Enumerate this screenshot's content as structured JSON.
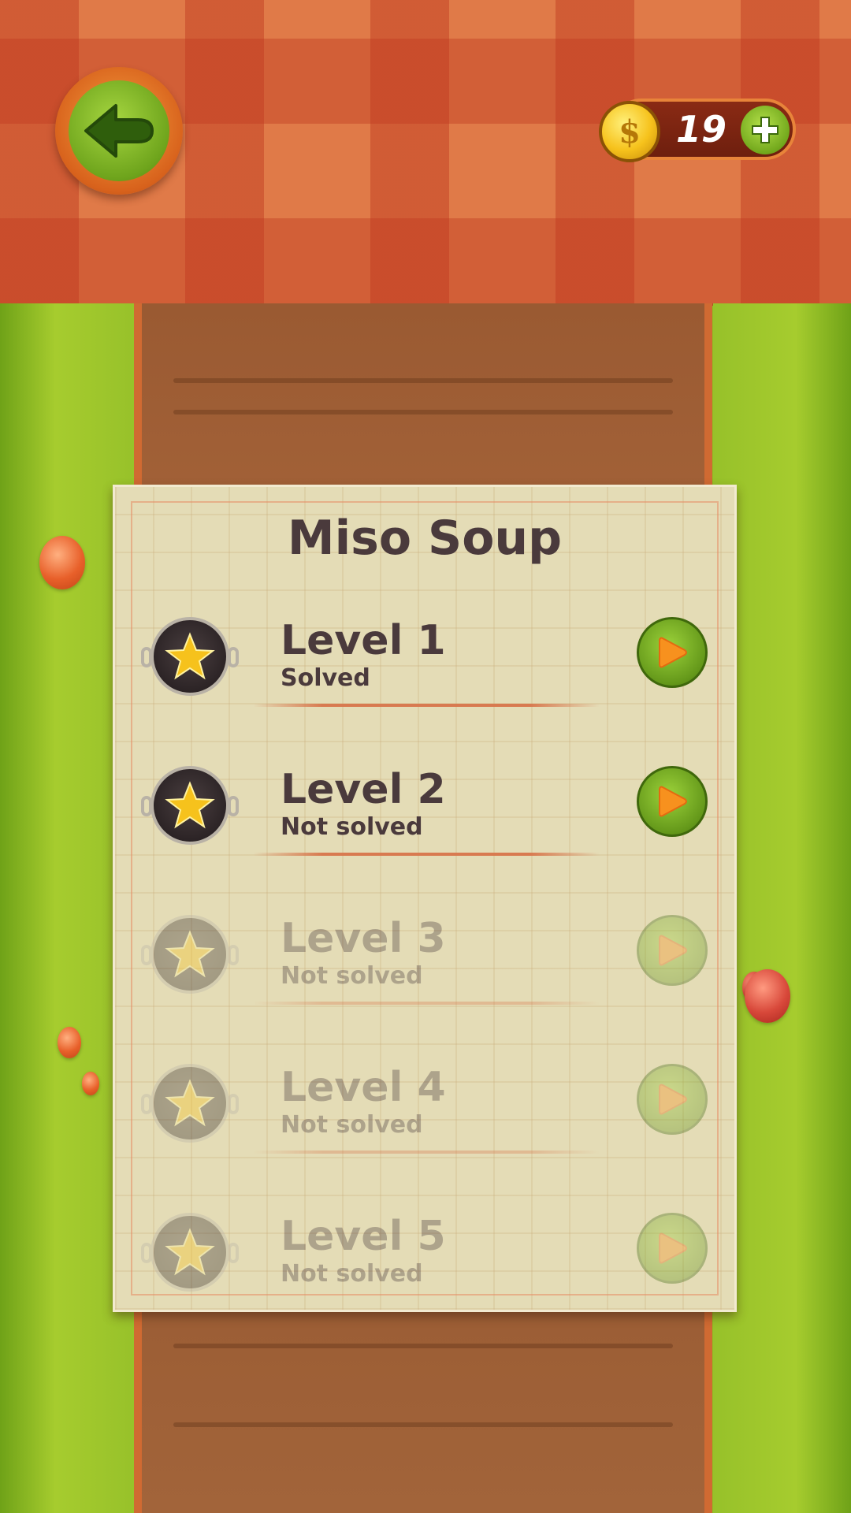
{
  "header": {
    "back_icon": "arrow-left-icon",
    "coins": {
      "icon": "dollar-coin-icon",
      "symbol": "$",
      "count": "19",
      "add_icon": "plus-icon"
    }
  },
  "card": {
    "title": "Miso Soup",
    "levels": [
      {
        "name": "Level 1",
        "status": "Solved",
        "unlocked": true
      },
      {
        "name": "Level 2",
        "status": "Not solved",
        "unlocked": true
      },
      {
        "name": "Level 3",
        "status": "Not solved",
        "unlocked": false
      },
      {
        "name": "Level 4",
        "status": "Not solved",
        "unlocked": false
      },
      {
        "name": "Level 5",
        "status": "Not solved",
        "unlocked": false
      }
    ]
  },
  "colors": {
    "tablecloth": "#e07a48",
    "grass": "#97c12a",
    "wood": "#a9673c",
    "paper": "#e4dcb6",
    "text": "#4a3a3c",
    "button_green": "#72a81c",
    "star": "#f6c21c"
  }
}
